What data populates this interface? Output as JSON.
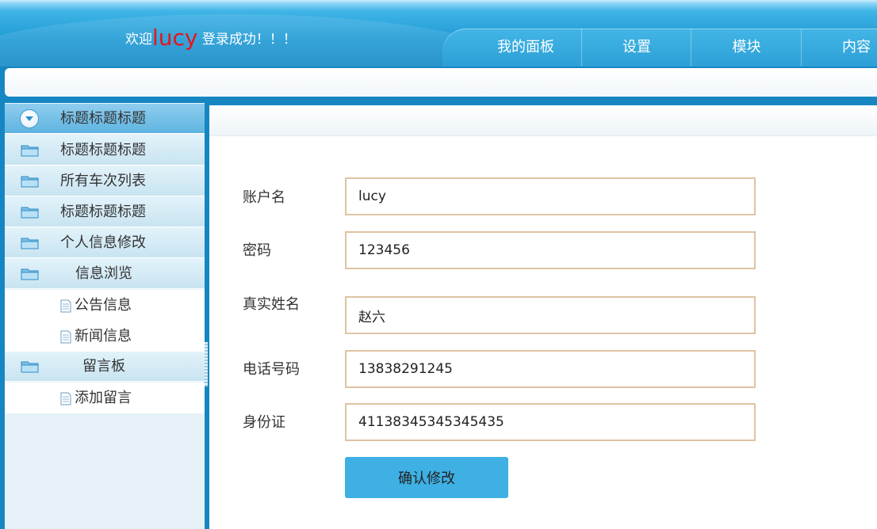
{
  "header": {
    "welcome_prefix": "欢迎",
    "username": "lucy",
    "welcome_suffix": "登录成功！！！",
    "nav": [
      "我的面板",
      "设置",
      "模块",
      "内容"
    ]
  },
  "sidebar": {
    "items": [
      {
        "label": "标题标题标题",
        "icon": "circle-down-icon",
        "active": true
      },
      {
        "label": "标题标题标题",
        "icon": "folder-icon"
      },
      {
        "label": "所有车次列表",
        "icon": "folder-icon"
      },
      {
        "label": "标题标题标题",
        "icon": "folder-icon"
      },
      {
        "label": "个人信息修改",
        "icon": "folder-icon"
      },
      {
        "label": "信息浏览",
        "icon": "folder-icon"
      },
      {
        "label": "公告信息",
        "icon": "document-icon"
      },
      {
        "label": "新闻信息",
        "icon": "document-icon"
      },
      {
        "label": "留言板",
        "icon": "folder-icon"
      },
      {
        "label": "添加留言",
        "icon": "document-icon"
      }
    ]
  },
  "form": {
    "fields": [
      {
        "label": "账户名",
        "value": "lucy"
      },
      {
        "label": "密码",
        "value": "123456"
      },
      {
        "label": "真实姓名",
        "value": "赵六"
      },
      {
        "label": "电话号码",
        "value": "13838291245"
      },
      {
        "label": "身份证",
        "value": "41138345345345435"
      }
    ],
    "submit_label": "确认修改"
  },
  "colors": {
    "header_blue": "#1f9ad5",
    "username_red": "#e8141c",
    "button_blue": "#3eb0e4",
    "input_border": "#dfc3a2"
  }
}
